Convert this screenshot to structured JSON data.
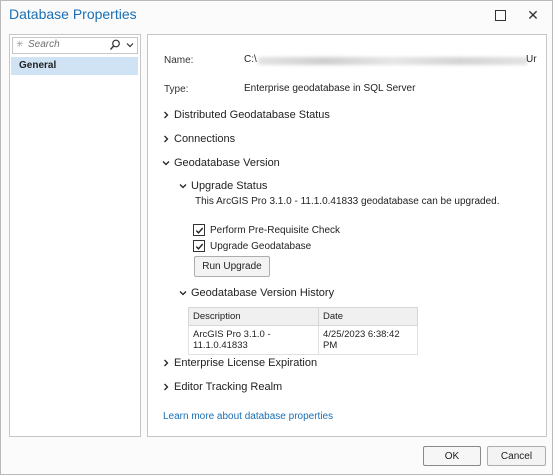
{
  "window": {
    "title": "Database Properties"
  },
  "sidebar": {
    "search_placeholder": "Search",
    "items": [
      {
        "label": "General"
      }
    ]
  },
  "general": {
    "name_label": "Name:",
    "name_prefix": "C:\\",
    "name_suffix": "Ur",
    "type_label": "Type:",
    "type_value": "Enterprise geodatabase in SQL Server",
    "sections": {
      "distributed": "Distributed Geodatabase Status",
      "connections": "Connections",
      "version": "Geodatabase Version",
      "license": "Enterprise License Expiration",
      "tracking": "Editor Tracking Realm"
    },
    "upgrade": {
      "title": "Upgrade Status",
      "message": "This ArcGIS Pro 3.1.0 - 11.1.0.41833 geodatabase can be upgraded.",
      "check_prereq_label": "Perform Pre-Requisite Check",
      "check_prereq_checked": true,
      "upgrade_gdb_label": "Upgrade Geodatabase",
      "upgrade_gdb_checked": true,
      "run_button": "Run Upgrade"
    },
    "history": {
      "title": "Geodatabase Version History",
      "columns": [
        "Description",
        "Date"
      ],
      "rows": [
        [
          "ArcGIS Pro 3.1.0 - 11.1.0.41833",
          "4/25/2023 6:38:42 PM"
        ]
      ]
    },
    "learn_more_link": "Learn more about database properties"
  },
  "footer": {
    "ok": "OK",
    "cancel": "Cancel"
  },
  "colors": {
    "title": "#1a6fb4",
    "link": "#1a6fb4",
    "selected_nav": "#cfe3f4"
  },
  "icons": {
    "search": "magnifier-icon",
    "dropdown": "chevron-down-icon",
    "collapsed": "chevron-right-icon",
    "expanded": "chevron-down-icon"
  }
}
